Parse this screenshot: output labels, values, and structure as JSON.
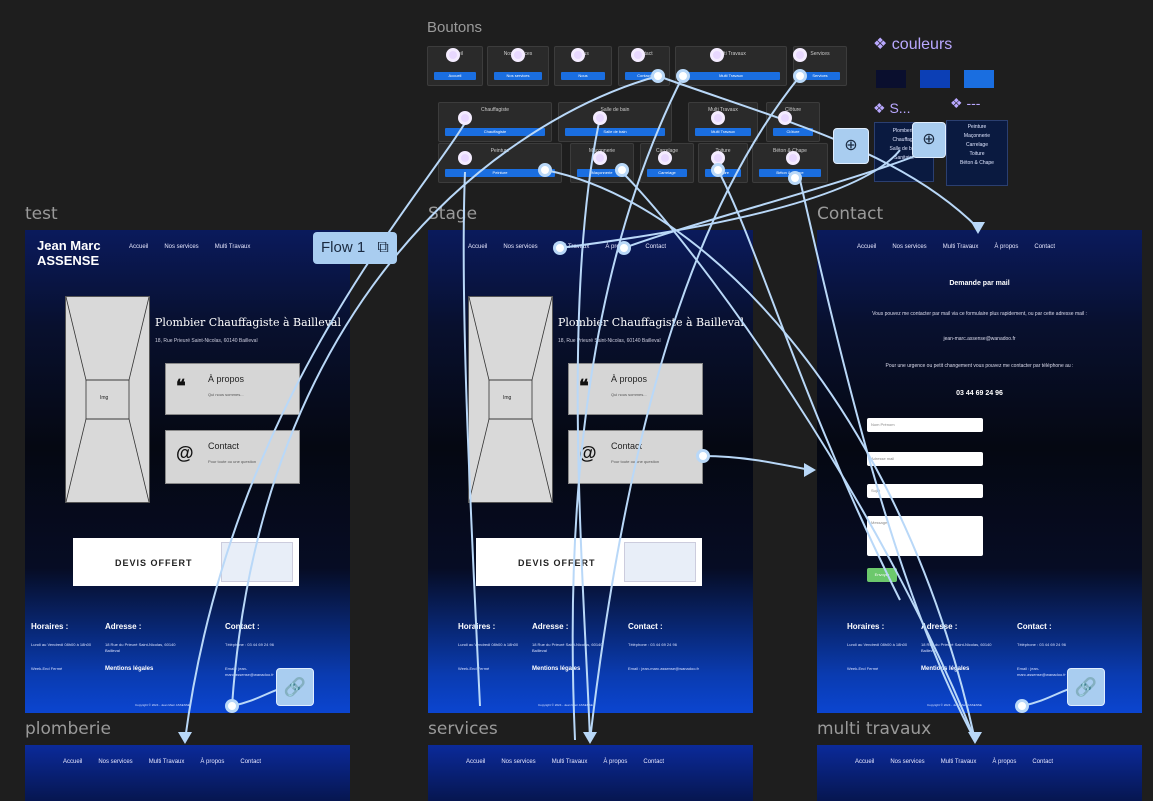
{
  "panels": {
    "boutons_title": "Boutons",
    "couleurs_title": "couleurs",
    "s_title": "S...",
    "dots_title": "---",
    "colors": [
      "#0a0f2e",
      "#0c3fb5",
      "#1a6ee0"
    ]
  },
  "buttons_row1": [
    {
      "label": "Accueil",
      "btn": "Accueil"
    },
    {
      "label": "Nos services",
      "btn": "Nos services"
    },
    {
      "label": "Nous",
      "btn": "Nous"
    },
    {
      "label": "Contact",
      "btn": "Contact"
    },
    {
      "label": "Multi Travaux",
      "btn": "Multi Travaux"
    },
    {
      "label": "Services",
      "btn": "Services"
    }
  ],
  "buttons_row2": [
    {
      "label": "Chauffagiste",
      "btn": "Chauffagiste"
    },
    {
      "label": "Salle de bain",
      "btn": "Salle de bain"
    },
    {
      "label": "Multi Travaux",
      "btn": "Multi Travaux"
    },
    {
      "label": "Clôture",
      "btn": "Clôture"
    }
  ],
  "buttons_row3": [
    {
      "label": "Peinture",
      "btn": "Peinture"
    },
    {
      "label": "Maçonnerie",
      "btn": "Maçonnerie"
    },
    {
      "label": "Carrelage",
      "btn": "Carrelage"
    },
    {
      "label": "Toiture",
      "btn": "Toiture"
    },
    {
      "label": "Béton & Chape",
      "btn": "Béton & Chape"
    }
  ],
  "menu_left": [
    "Plomberie",
    "Chauffage",
    "Salle de bain",
    "Sanitaire"
  ],
  "menu_right": [
    "Peinture",
    "Maçonnerie",
    "Carrelage",
    "Toiture",
    "Béton & Chape"
  ],
  "frames": {
    "test": "test",
    "stage": "Stage",
    "contact": "Contact",
    "plomberie": "plomberie",
    "services": "services",
    "multi": "multi travaux"
  },
  "flow_label": "Flow 1",
  "site": {
    "logo_line1": "Jean Marc",
    "logo_line2": "ASSENSE",
    "nav": [
      "Accueil",
      "Nos services",
      "Multi Travaux",
      "À propos",
      "Contact"
    ],
    "hero_title": "Plombier Chauffagiste à Bailleval",
    "hero_address": "18, Rue Prieuré Saint-Nicolas, 60140 Bailleval",
    "img_label": "Img",
    "card_about_title": "À propos",
    "card_about_sub": "Qui nous sommes...",
    "card_contact_title": "Contact",
    "card_contact_sub": "Pour toute ou une question",
    "devis": "DEVIS OFFERT",
    "foot_horaires": "Horaires :",
    "foot_horaires_text": "Lundi au Vendredi 08h00 à 18h00",
    "foot_weekend": "Week-End Fermé",
    "foot_adresse": "Adresse :",
    "foot_adresse_text": "18 Rue du Prieuré Saint-Nicolas, 60140 Bailleval",
    "foot_mentions": "Mentions légales",
    "foot_contact": "Contact :",
    "foot_tel": "Téléphone : 03 44 69 24 96",
    "foot_email": "Email : jean-marc.assense@wanadoo.fr",
    "copyright": "Copyright © 2024 - Jean Marc ASSENSE"
  },
  "contact_page": {
    "title": "Demande par mail",
    "intro": "Vous pouvez me contacter par mail via ce formulaire plus rapidement, ou par cette adresse mail :",
    "email": "jean-marc.assense@wanadoo.fr",
    "urgent": "Pour une urgence ou petit changement vous pouvez me contacter par téléphone au :",
    "phone": "03 44 69 24 96",
    "ph_name": "Nom Prénom",
    "ph_email": "Adresse mail",
    "ph_subject": "Sujet",
    "ph_message": "Message",
    "submit": "Envoyer"
  }
}
